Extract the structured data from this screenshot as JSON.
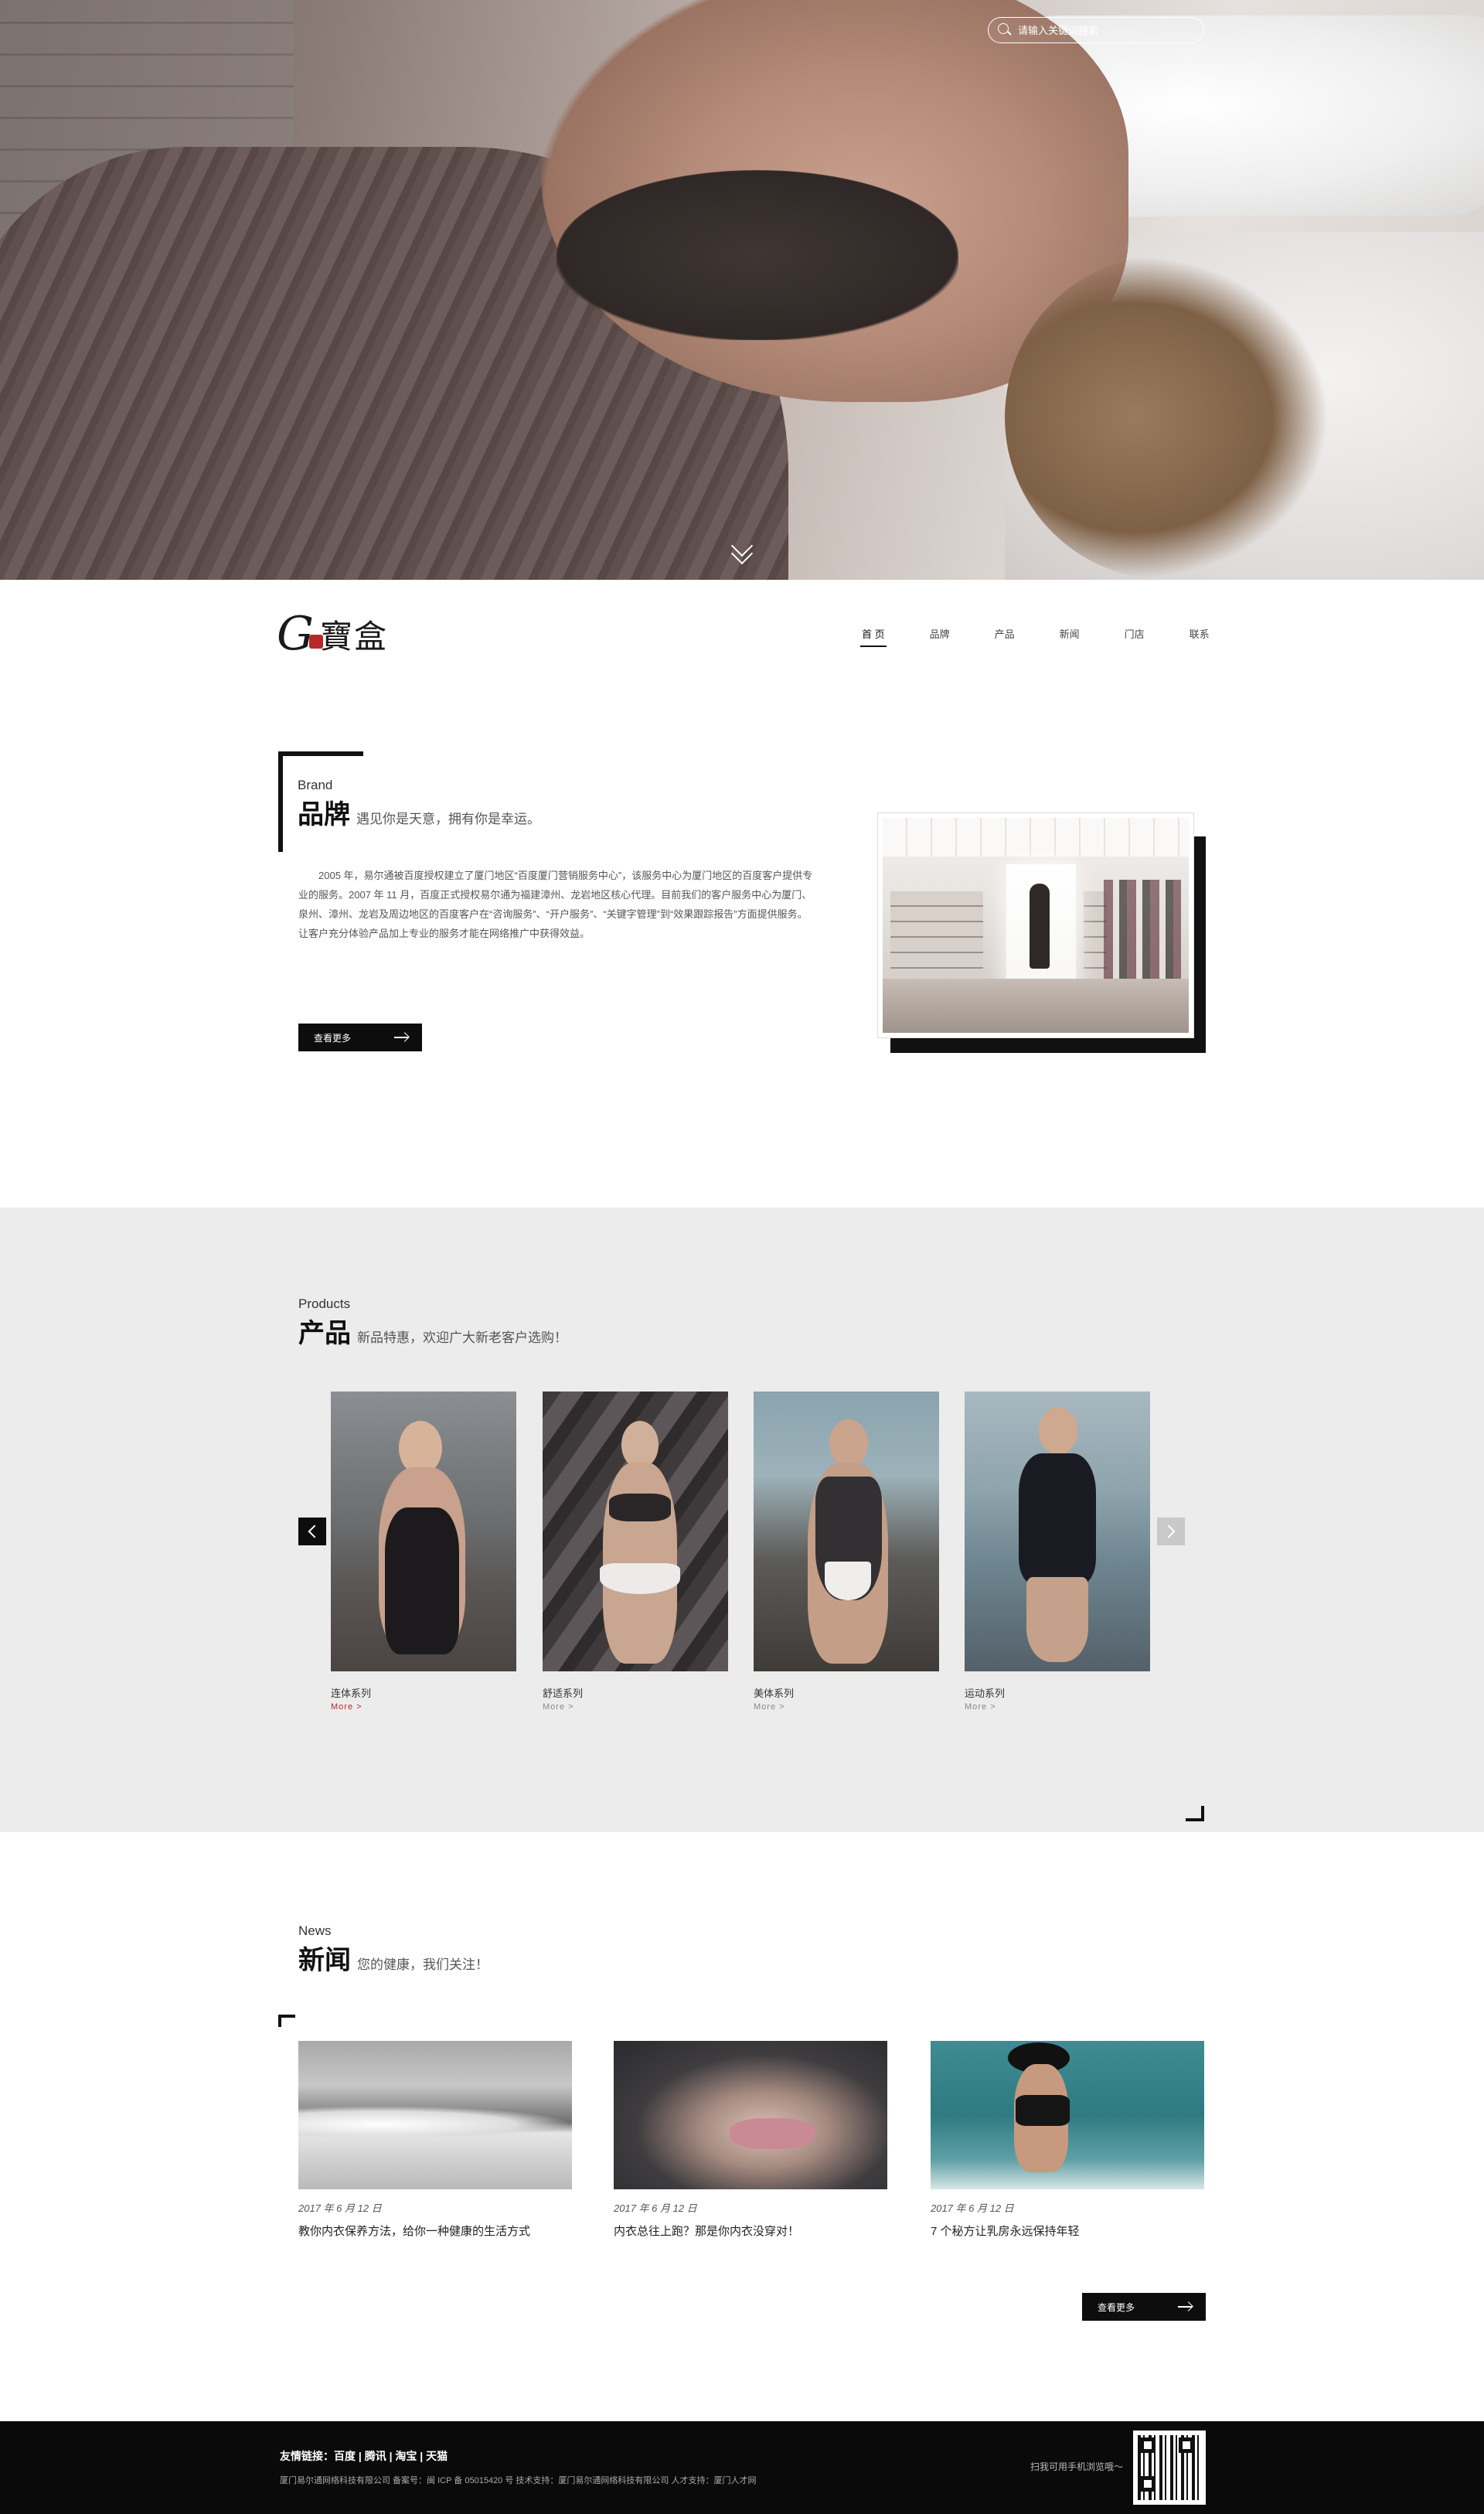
{
  "hero": {
    "search": {
      "placeholder": "请输入关键词搜索"
    }
  },
  "header": {
    "logo": {
      "latin": "G",
      "cn": "寶盒"
    },
    "nav": [
      "首 页",
      "品牌",
      "产品",
      "新闻",
      "门店",
      "联系"
    ],
    "nav_active_index": 0
  },
  "brand": {
    "en": "Brand",
    "cn": "品牌",
    "slogan": "遇见你是天意，拥有你是幸运。",
    "body": "2005 年，易尔通被百度授权建立了厦门地区“百度厦门营销服务中心”，该服务中心为厦门地区的百度客户提供专业的服务。2007 年 11 月，百度正式授权易尔通为福建漳州、龙岩地区核心代理。目前我们的客户服务中心为厦门、泉州、漳州、龙岩及周边地区的百度客户在“咨询服务”、“开户服务”、“关键字管理”到“效果跟踪报告”方面提供服务。让客户充分体验产品加上专业的服务才能在网络推广中获得效益。",
    "more_label": "查看更多"
  },
  "products": {
    "en": "Products",
    "cn": "产品",
    "slogan": "新品特惠，欢迎广大新老客户选购！",
    "items": [
      {
        "name": "连体系列",
        "more": "More >"
      },
      {
        "name": "舒适系列",
        "more": "More >"
      },
      {
        "name": "美体系列",
        "more": "More >"
      },
      {
        "name": "运动系列",
        "more": "More >"
      }
    ]
  },
  "news": {
    "en": "News",
    "cn": "新闻",
    "slogan": "您的健康，我们关注！",
    "items": [
      {
        "date": "2017 年 6 月 12 日",
        "title": "教你内衣保养方法，给你一种健康的生活方式"
      },
      {
        "date": "2017 年 6 月 12 日",
        "title": "内衣总往上跑？那是你内衣没穿对！"
      },
      {
        "date": "2017 年 6 月 12 日",
        "title": "7 个秘方让乳房永远保持年轻"
      }
    ],
    "more_label": "查看更多"
  },
  "footer": {
    "links_prefix": "友情链接：",
    "links": [
      "百度",
      "腾讯",
      "淘宝",
      "天猫"
    ],
    "copyright": "厦门易尔通网络科技有限公司  备案号：闽 ICP 备 05015420 号  技术支持：厦门易尔通网络科技有限公司  人才支持：厦门人才网",
    "scan_text": "扫我可用手机浏览哦～"
  },
  "colors": {
    "accent_dark": "#0d0d0d",
    "products_bg": "#ececec",
    "more_red": "#c0272d"
  }
}
